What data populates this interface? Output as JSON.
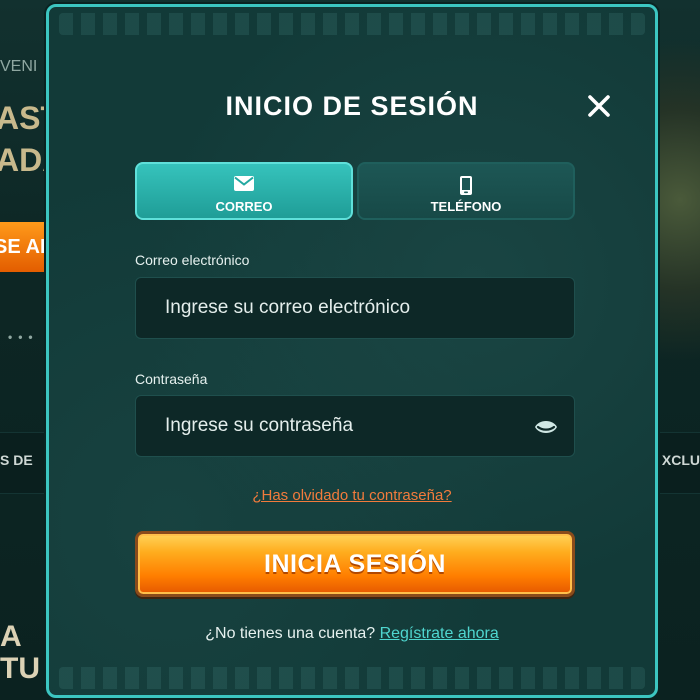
{
  "background": {
    "text_bienveni": "VENI",
    "text_ast": "AST",
    "text_ada": "ADA",
    "button_partial": "SE AI",
    "nav_left": "S   DE",
    "nav_right": "XCLU",
    "hero_a": "A",
    "hero_tu": "TU"
  },
  "modal": {
    "title": "INICIO DE SESIÓN",
    "close_icon": "close-icon",
    "tabs": [
      {
        "label": "CORREO",
        "icon": "envelope-icon",
        "active": true
      },
      {
        "label": "TELÉFONO",
        "icon": "phone-icon",
        "active": false
      }
    ],
    "email": {
      "label": "Correo electrónico",
      "placeholder": "Ingrese su correo electrónico",
      "value": ""
    },
    "password": {
      "label": "Contraseña",
      "placeholder": "Ingrese su contraseña",
      "value": "",
      "toggle_icon": "eye-icon"
    },
    "forgot_link": "¿Has olvidado tu contraseña?",
    "submit_label": "INICIA SESIÓN",
    "signup_prompt": "¿No tienes una cuenta?",
    "signup_link": "Regístrate ahora"
  },
  "colors": {
    "accent": "#3cc6c1",
    "modal_bg": "#123a38",
    "submit": "#ff8a00",
    "link_orange": "#f27b3c",
    "link_teal": "#4fd6cf"
  }
}
